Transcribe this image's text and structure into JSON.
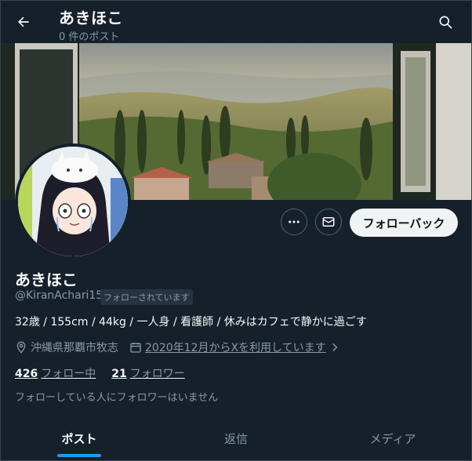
{
  "header": {
    "title": "あきほこ",
    "post_count": "0 件のポスト",
    "back_icon": "arrow-left-icon",
    "search_icon": "search-icon"
  },
  "profile": {
    "name": "あきほこ",
    "handle": "@KiranAchari15",
    "follows_you_badge": "フォローされています",
    "bio": "32歳 / 155cm / 44kg / 一人身 / 看護師 / 休みはカフェで静かに過ごす",
    "location": "沖縄県那覇市牧志",
    "joined": "2020年12月からXを利用しています",
    "following_count": "426",
    "following_label": "フォロー中",
    "followers_count": "21",
    "followers_label": "フォロワー",
    "mutual_note": "フォローしている人にフォロワーはいません"
  },
  "actions": {
    "follow_back_label": "フォローバック",
    "more_icon": "more-icon",
    "message_icon": "mail-icon"
  },
  "tabs": [
    {
      "label": "ポスト",
      "active": true
    },
    {
      "label": "返信",
      "active": false
    },
    {
      "label": "メディア",
      "active": false
    }
  ],
  "colors": {
    "background": "#15202b",
    "accent": "#1d9bf0",
    "muted_text": "#8b98a5",
    "button_bg": "#eff3f4"
  }
}
